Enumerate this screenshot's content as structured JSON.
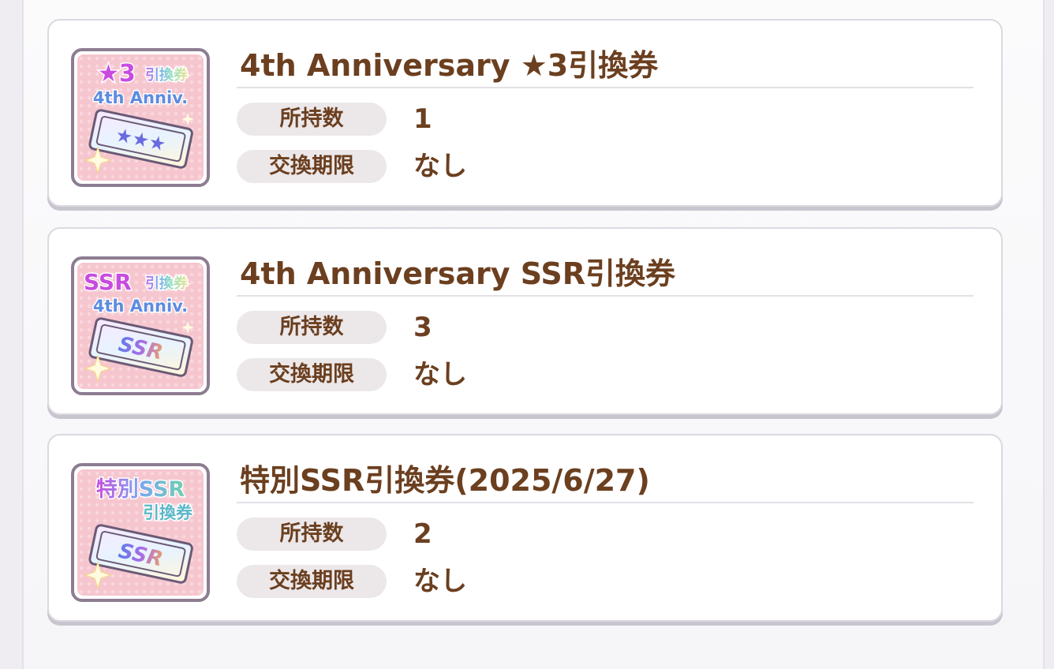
{
  "items": [
    {
      "title": "4th Anniversary ★3引換券",
      "owned_label": "所持数",
      "owned_value": "1",
      "expiry_label": "交換期限",
      "expiry_value": "なし",
      "icon": {
        "line1": "★3",
        "line1_small": "引換券",
        "line2": "4th Anniv.",
        "ticket_text": "★★★"
      }
    },
    {
      "title": "4th Anniversary SSR引換券",
      "owned_label": "所持数",
      "owned_value": "3",
      "expiry_label": "交換期限",
      "expiry_value": "なし",
      "icon": {
        "line1": "SSR",
        "line1_small": "引換券",
        "line2": "4th Anniv.",
        "ticket_text": "SSR"
      }
    },
    {
      "title": "特別SSR引換券(2025/6/27)",
      "owned_label": "所持数",
      "owned_value": "2",
      "expiry_label": "交換期限",
      "expiry_value": "なし",
      "icon": {
        "line1": "特別SSR",
        "line1_small": "",
        "line2": "引換券",
        "ticket_text": "SSR"
      }
    }
  ],
  "colors": {
    "text_brown": "#6b3f1f",
    "pill_bg": "#ece8ea",
    "icon_pink": "#f6c6cf",
    "frame": "#8d7d91"
  }
}
